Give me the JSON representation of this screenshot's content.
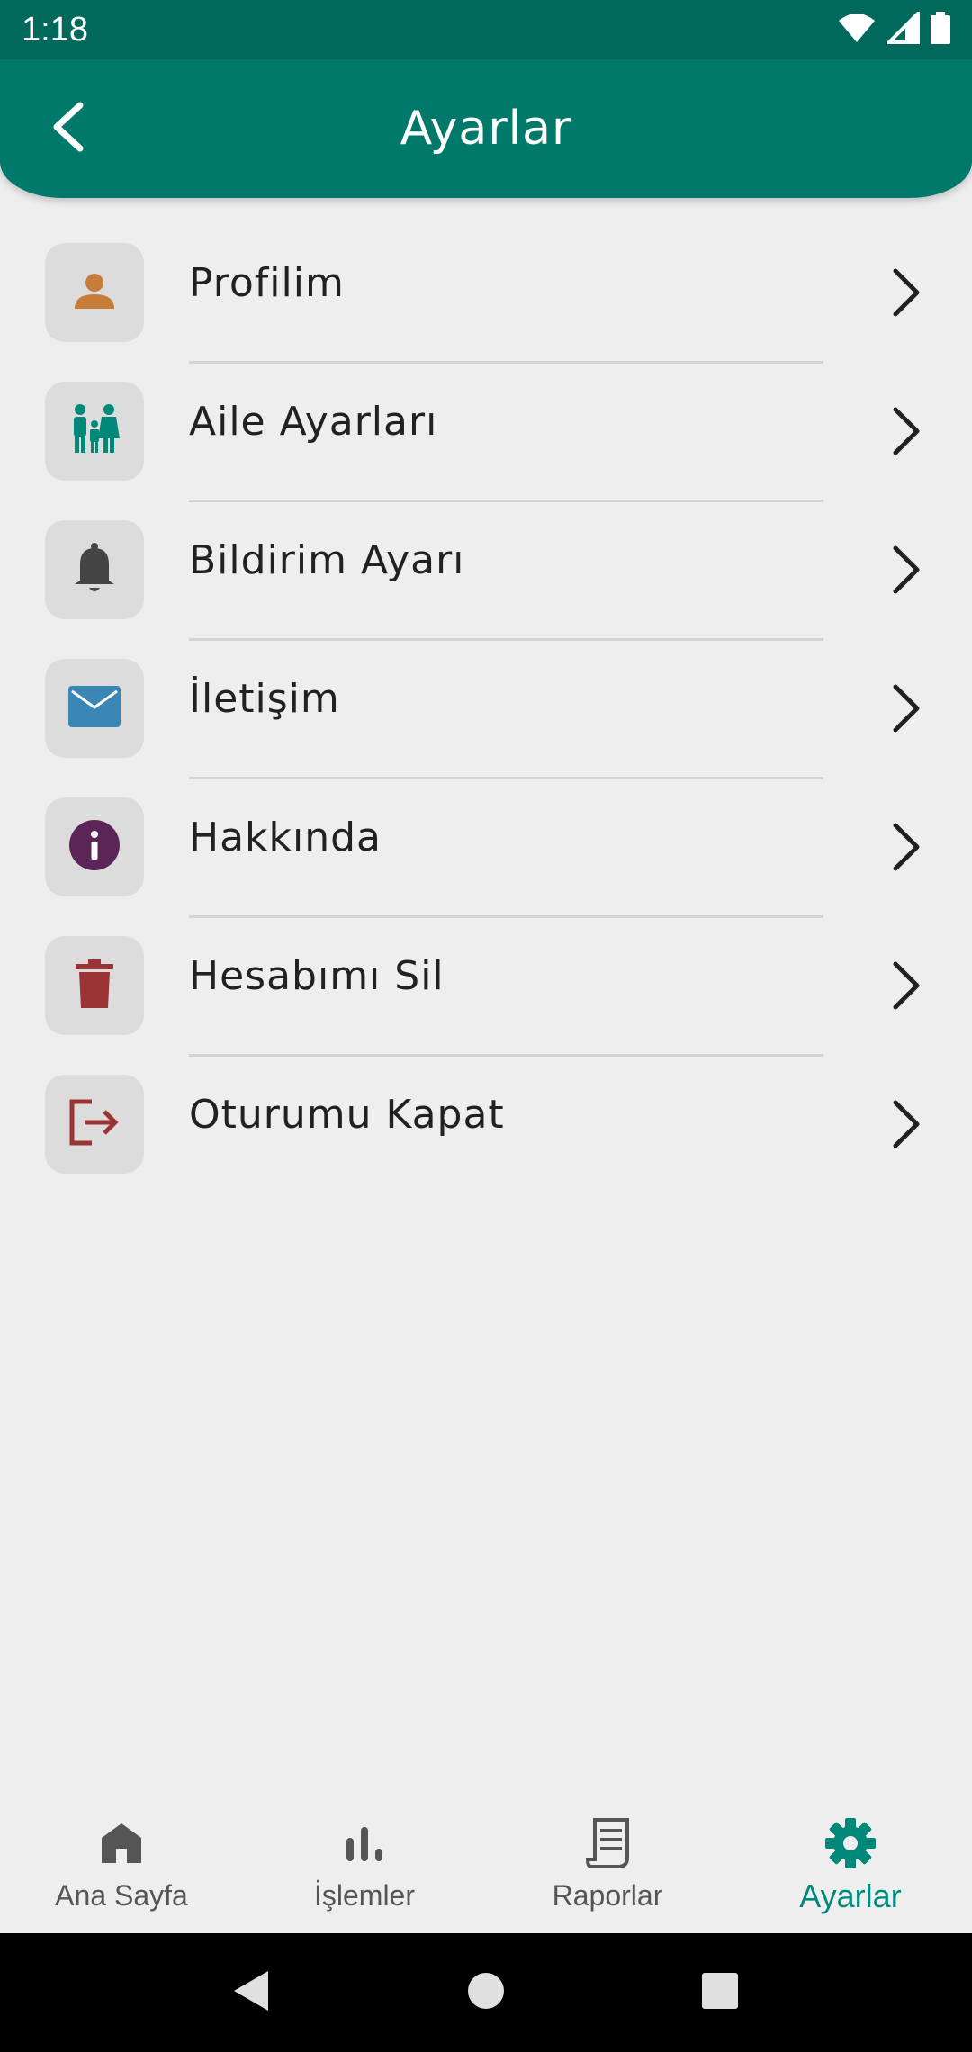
{
  "status_bar": {
    "time": "1:18",
    "icons": [
      "wifi-icon",
      "signal-icon",
      "battery-icon"
    ]
  },
  "app_bar": {
    "title": "Ayarlar",
    "back_icon": "chevron-left-icon"
  },
  "menu": {
    "items": [
      {
        "label": "Profilim",
        "icon": "person-icon",
        "icon_color": "#c77d3a"
      },
      {
        "label": "Aile Ayarları",
        "icon": "family-icon",
        "icon_color": "#00897b"
      },
      {
        "label": "Bildirim Ayarı",
        "icon": "bell-icon",
        "icon_color": "#444444"
      },
      {
        "label": "İletişim",
        "icon": "mail-icon",
        "icon_color": "#3a87b5"
      },
      {
        "label": "Hakkında",
        "icon": "info-icon",
        "icon_color": "#5b2557"
      },
      {
        "label": "Hesabımı Sil",
        "icon": "trash-icon",
        "icon_color": "#9b3535"
      },
      {
        "label": "Oturumu Kapat",
        "icon": "logout-icon",
        "icon_color": "#9b3535"
      }
    ]
  },
  "bottom_nav": {
    "items": [
      {
        "label": "Ana Sayfa",
        "icon": "home-icon",
        "active": false
      },
      {
        "label": "İşlemler",
        "icon": "bar-chart-icon",
        "active": false
      },
      {
        "label": "Raporlar",
        "icon": "receipt-icon",
        "active": false
      },
      {
        "label": "Ayarlar",
        "icon": "gear-icon",
        "active": true
      }
    ],
    "active_color": "#00897b"
  },
  "colors": {
    "primary": "#00796b",
    "status_bar": "#00695c",
    "background": "#eeeeee"
  }
}
